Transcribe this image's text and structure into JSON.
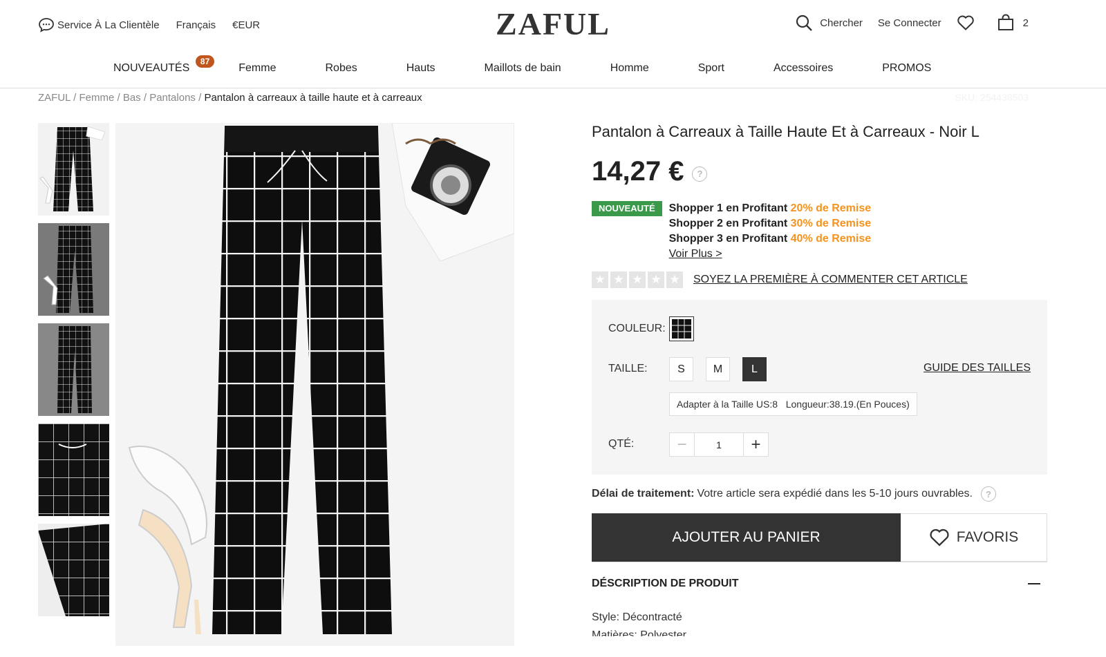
{
  "topbar": {
    "service": "Service À La Clientèle",
    "language": "Français",
    "currency": "€EUR",
    "logo": "ZAFUL",
    "search": "Chercher",
    "login": "Se Connecter",
    "cart_count": "2"
  },
  "nav": {
    "items": [
      {
        "label": "NOUVEAUTÉS",
        "badge": "87"
      },
      {
        "label": "Femme"
      },
      {
        "label": "Robes"
      },
      {
        "label": "Hauts"
      },
      {
        "label": "Maillots de bain"
      },
      {
        "label": "Homme"
      },
      {
        "label": "Sport"
      },
      {
        "label": "Accessoires"
      },
      {
        "label": "PROMOS"
      }
    ]
  },
  "breadcrumb": {
    "items": [
      "ZAFUL",
      "Femme",
      "Bas",
      "Pantalons"
    ],
    "current": "Pantalon à carreaux à taille haute et à carreaux",
    "sku": "SKU: 254438503"
  },
  "product": {
    "title": "Pantalon à Carreaux à Taille Haute Et à Carreaux - Noir L",
    "price": "14,27 €",
    "new_badge": "NOUVEAUTÉ",
    "promos": [
      {
        "text": "Shopper 1 en Profitant ",
        "discount": "20% de Remise"
      },
      {
        "text": "Shopper 2 en Profitant ",
        "discount": "30% de Remise"
      },
      {
        "text": "Shopper 3 en Profitant ",
        "discount": "40% de Remise"
      }
    ],
    "voir_plus": "Voir Plus >",
    "review_link": "SOYEZ LA PREMIÈRE À COMMENTER CET ARTICLE",
    "rating": 0,
    "rating_max": 5
  },
  "options": {
    "color_label": "COULEUR:",
    "size_label": "TAILLE:",
    "sizes": [
      "S",
      "M",
      "L"
    ],
    "selected_size": "L",
    "size_guide": "GUIDE DES TAILLES",
    "fit": "Adapter à la Taille US:8   Longueur:38.19.(En Pouces)",
    "qty_label": "QTÉ:",
    "qty": "1"
  },
  "delivery": {
    "label": "Délai de traitement:",
    "text": "Votre article sera expédié dans les 5-10 jours ouvrables."
  },
  "actions": {
    "add_to_cart": "AJOUTER AU PANIER",
    "favorites": "FAVORIS"
  },
  "description": {
    "header": "DÉSCRIPTION DE PRODUIT",
    "style": "Style: Décontracté",
    "material": "Matières: Polyester"
  },
  "colors": {
    "promo_orange": "#f5931e",
    "new_green": "#3a9a4a",
    "badge_orange": "#c0561e",
    "dark": "#333333"
  }
}
